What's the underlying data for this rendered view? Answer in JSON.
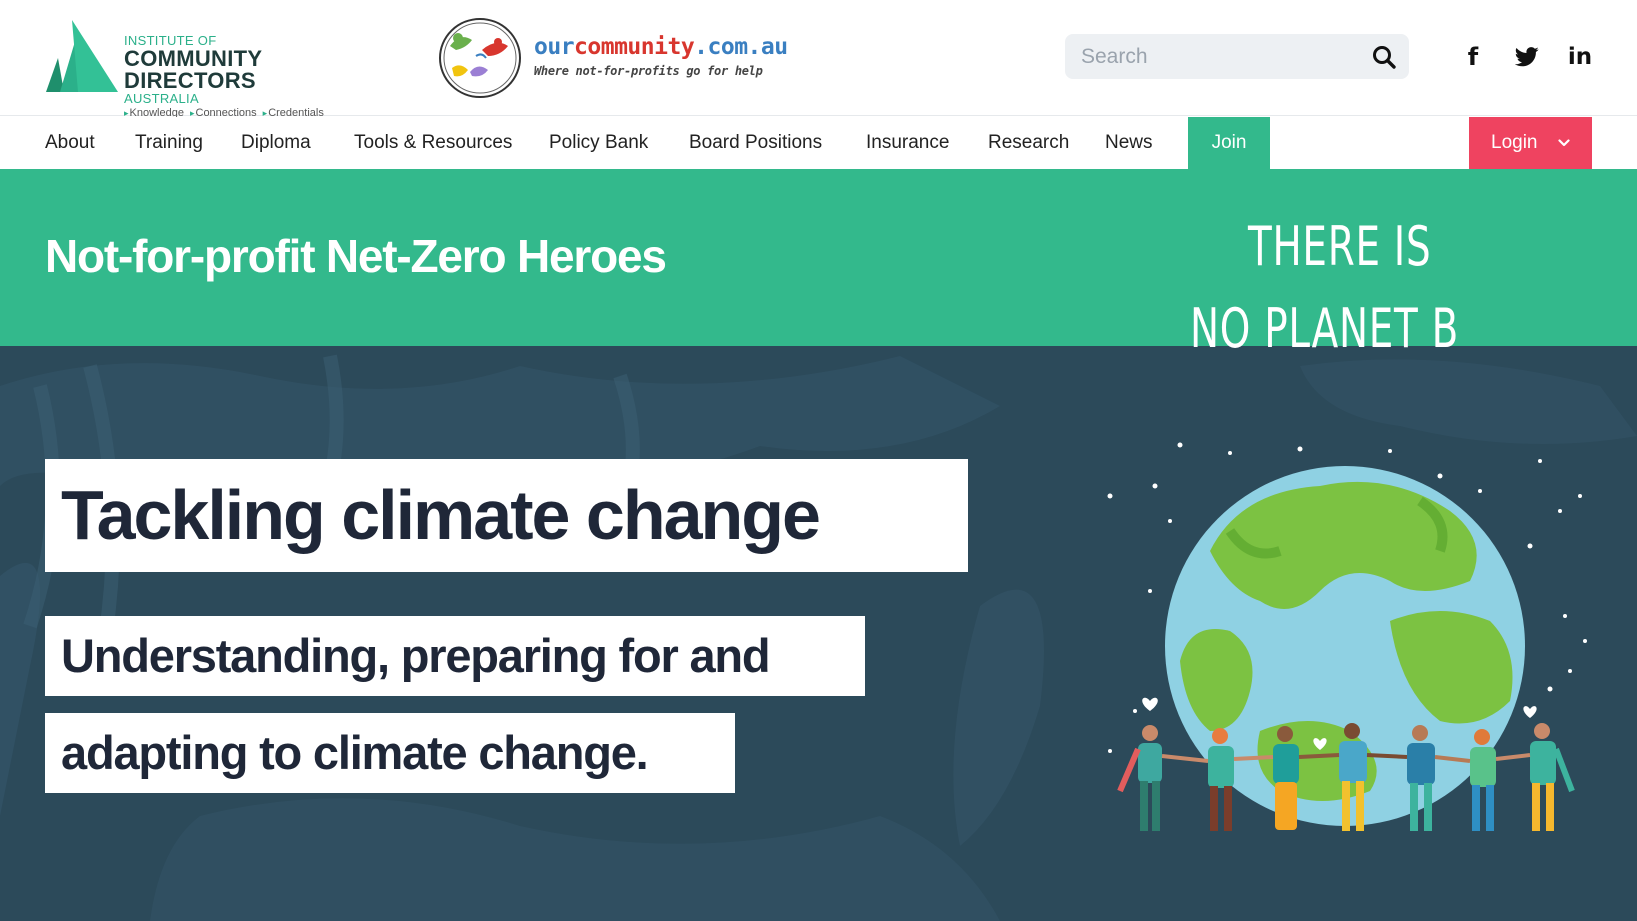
{
  "header": {
    "icd_logo": {
      "line1": "INSTITUTE OF",
      "line2": "COMMUNITY DIRECTORS",
      "line3": "AUSTRALIA",
      "tags": [
        "Knowledge",
        "Connections",
        "Credentials"
      ]
    },
    "oc_logo": {
      "name_part1": "our",
      "name_part2": "community",
      "name_part3": ".com.au",
      "tagline": "Where not-for-profits go for help"
    },
    "search": {
      "placeholder": "Search",
      "value": "",
      "icon": "search-icon"
    },
    "social": [
      {
        "icon": "facebook-icon",
        "glyph": "f"
      },
      {
        "icon": "twitter-icon"
      },
      {
        "icon": "linkedin-icon",
        "glyph": "in"
      }
    ]
  },
  "nav": {
    "items": [
      "About",
      "Training",
      "Diploma",
      "Tools & Resources",
      "Policy Bank",
      "Board Positions",
      "Insurance",
      "Research",
      "News"
    ],
    "join_label": "Join",
    "login_label": "Login",
    "colors": {
      "join": "#33b98c",
      "login": "#ef4360"
    }
  },
  "banner": {
    "title": "Not-for-profit Net-Zero Heroes",
    "color": "#33b98c"
  },
  "hero": {
    "headline": "Tackling climate change",
    "subline1": "Understanding, preparing for and",
    "subline2": "adapting to climate change.",
    "illustration": {
      "text_line1": "THERE IS",
      "text_line2": "NO PLANET B"
    },
    "background_color": "#2c4a5a"
  }
}
